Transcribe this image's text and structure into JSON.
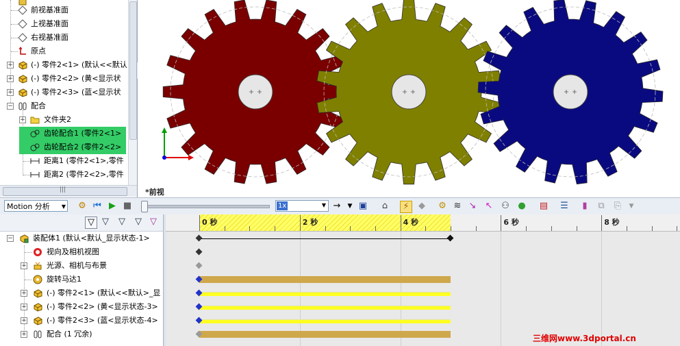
{
  "feature_tree": {
    "items": [
      {
        "label": "前视基准面",
        "icon": "plane-icon"
      },
      {
        "label": "上视基准面",
        "icon": "plane-icon"
      },
      {
        "label": "右视基准面",
        "icon": "plane-icon"
      },
      {
        "label": "原点",
        "icon": "origin-icon"
      },
      {
        "label": "(-) 零件2<1> (默认<<默认",
        "icon": "part-icon"
      },
      {
        "label": "(-) 零件2<2> (黄<显示状",
        "icon": "part-icon"
      },
      {
        "label": "(-) 零件2<3> (蓝<显示状",
        "icon": "part-icon"
      },
      {
        "label": "配合",
        "icon": "mates-icon"
      },
      {
        "label": "文件夹2",
        "icon": "folder-icon"
      },
      {
        "label": "齿轮配合1 (零件2<1>",
        "icon": "gear-mate-icon"
      },
      {
        "label": "齿轮配合2 (零件2<2>",
        "icon": "gear-mate-icon"
      },
      {
        "label": "距离1 (零件2<1>,零件",
        "icon": "distance-mate-icon"
      },
      {
        "label": "距离2 (零件2<2>,零件",
        "icon": "distance-mate-icon"
      }
    ],
    "scroll_grip": "|||"
  },
  "viewport": {
    "view_label": "*前视",
    "gears": [
      {
        "color": "#7a0000"
      },
      {
        "color": "#808000"
      },
      {
        "color": "#0a0a80"
      }
    ],
    "triad_colors": {
      "x": "#e00000",
      "y": "#00a000",
      "z": "#0000e0"
    }
  },
  "motion_toolbar": {
    "study_type": "Motion 分析",
    "speed": "1x"
  },
  "timeline": {
    "tick_labels": [
      "0 秒",
      "2 秒",
      "4 秒",
      "6 秒",
      "8 秒"
    ],
    "highlight_end_seconds": 5
  },
  "motion_tree": {
    "items": [
      {
        "label": "装配体1  (默认<默认_显示状态-1>",
        "icon": "assembly-icon"
      },
      {
        "label": "视向及相机视图",
        "icon": "camera-view-icon"
      },
      {
        "label": "光源、相机与布景",
        "icon": "lights-icon"
      },
      {
        "label": "旋转马达1",
        "icon": "rotary-motor-icon"
      },
      {
        "label": "(-) 零件2<1> (默认<<默认>_显",
        "icon": "part-icon"
      },
      {
        "label": "(-) 零件2<2> (黄<显示状态-3>",
        "icon": "part-icon"
      },
      {
        "label": "(-) 零件2<3> (蓝<显示状态-4>",
        "icon": "part-icon"
      },
      {
        "label": "配合 (1 冗余)",
        "icon": "mates-icon"
      }
    ]
  },
  "watermark": "三维网www.3dportal.cn"
}
